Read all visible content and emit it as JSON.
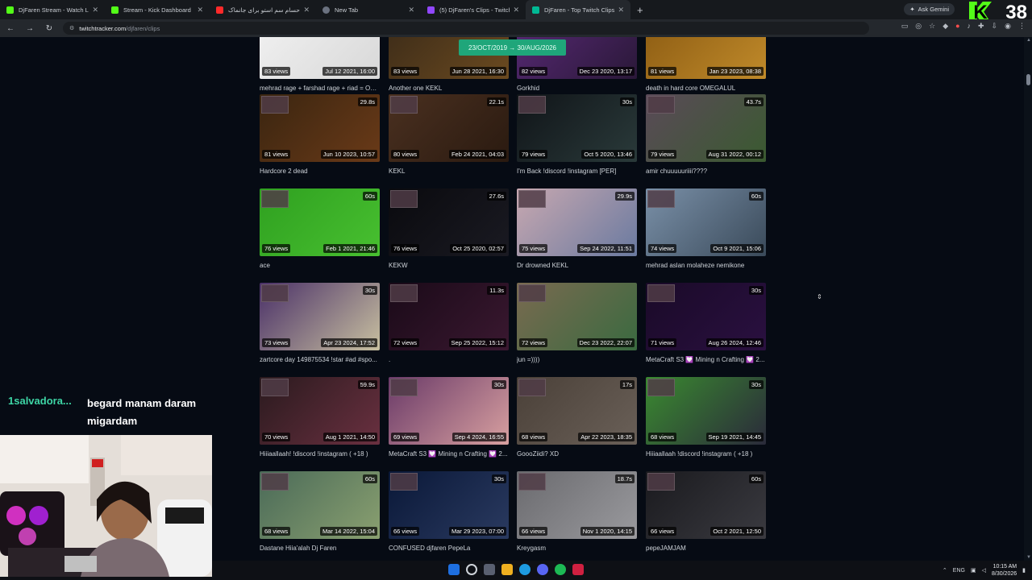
{
  "browser": {
    "tabs": [
      {
        "label": "DjFaren Stream - Watch Live o",
        "icon": "kick",
        "active": false
      },
      {
        "label": "Stream - Kick Dashboard",
        "icon": "kick",
        "active": false
      },
      {
        "label": "جیران حسام سم استو برای جانماک",
        "icon": "yt",
        "active": false
      },
      {
        "label": "New Tab",
        "icon": "nt",
        "active": false
      },
      {
        "label": "(5) DjFaren's Clips - Twitch",
        "icon": "tw",
        "active": false
      },
      {
        "label": "DjFaren - Top Twitch Clips",
        "icon": "tt",
        "active": true
      }
    ],
    "new_tab": "+",
    "ask_gemini": "Ask Gemini",
    "address": {
      "domain": "twitchtracker.com",
      "path": "/djfaren/clips"
    }
  },
  "overlay": {
    "viewer_count": "38",
    "chat_user": "1salvadora...",
    "chat_message": "begard manam daram migardam"
  },
  "date_range": "23/OCT/2019 → 30/AUG/2026",
  "clips": [
    [
      {
        "views": "83 views",
        "date": "Jul 12 2021, 16:00",
        "duration": "",
        "title": "mehrad rage + farshad rage + riad = OM...",
        "bg": "#f2f2f2",
        "bg2": "#d8d8d8"
      },
      {
        "views": "83 views",
        "date": "Jun 28 2021, 16:30",
        "duration": "",
        "title": "Another one KEKL",
        "bg": "#3a2a18",
        "bg2": "#6b4a20"
      },
      {
        "views": "82 views",
        "date": "Dec 23 2020, 13:17",
        "duration": "",
        "title": "Gorkhid",
        "bg": "#5a2a78",
        "bg2": "#2a1838"
      },
      {
        "views": "81 views",
        "date": "Jan 23 2023, 08:38",
        "duration": "",
        "title": "death in hard core OMEGALUL",
        "bg": "#8a5a12",
        "bg2": "#c08a2a"
      }
    ],
    [
      {
        "views": "81 views",
        "date": "Jun 10 2023, 10:57",
        "duration": "29.8s",
        "title": "Hardcore 2 dead",
        "bg": "#3a2510",
        "bg2": "#6a3a18"
      },
      {
        "views": "80 views",
        "date": "Feb 24 2021, 04:03",
        "duration": "22.1s",
        "title": "KEKL",
        "bg": "#4a3020",
        "bg2": "#2a1a10"
      },
      {
        "views": "79 views",
        "date": "Oct 5 2020, 13:46",
        "duration": "30s",
        "title": "I'm Back !discord !instagram [PER]",
        "bg": "#101418",
        "bg2": "#2a3a3a"
      },
      {
        "views": "79 views",
        "date": "Aug 31 2022, 00:12",
        "duration": "43.7s",
        "title": "amir chuuuuuriiii????",
        "bg": "#5a4a58",
        "bg2": "#3a5a30"
      }
    ],
    [
      {
        "views": "76 views",
        "date": "Feb 1 2021, 21:46",
        "duration": "60s",
        "title": "ace",
        "bg": "#2fa020",
        "bg2": "#48c030"
      },
      {
        "views": "76 views",
        "date": "Oct 25 2020, 02:57",
        "duration": "27.6s",
        "title": "KEKW",
        "bg": "#0a0a0e",
        "bg2": "#1a1a22"
      },
      {
        "views": "75 views",
        "date": "Sep 24 2022, 11:51",
        "duration": "29.9s",
        "title": "Dr drowned KEKL",
        "bg": "#c8a8b0",
        "bg2": "#6a7aa0"
      },
      {
        "views": "74 views",
        "date": "Oct 9 2021, 15:06",
        "duration": "60s",
        "title": "mehrad aslan molaheze nemikone",
        "bg": "#7a90a8",
        "bg2": "#3a4a5a"
      }
    ],
    [
      {
        "views": "73 views",
        "date": "Apr 23 2024, 17:52",
        "duration": "30s",
        "title": "zartcore day 149875534 !star #ad #spo...",
        "bg": "#4a3068",
        "bg2": "#c8c0a0"
      },
      {
        "views": "72 views",
        "date": "Sep 25 2022, 15:12",
        "duration": "11.3s",
        "title": ".",
        "bg": "#1a0a18",
        "bg2": "#3a1830"
      },
      {
        "views": "72 views",
        "date": "Dec 23 2022, 22:07",
        "duration": "",
        "title": "jun =))))",
        "bg": "#7a6a50",
        "bg2": "#3a6a40"
      },
      {
        "views": "71 views",
        "date": "Aug 26 2024, 12:46",
        "duration": "30s",
        "title": "MetaCraft S3 💟 Mining n Crafting 💟 2...",
        "bg": "#1a0a28",
        "bg2": "#2a1040"
      }
    ],
    [
      {
        "views": "70 views",
        "date": "Aug 1 2021, 14:50",
        "duration": "59.9s",
        "title": "Hiiiaallaah! !discord !instagram ( +18 )",
        "bg": "#2a1a1e",
        "bg2": "#6a3040"
      },
      {
        "views": "69 views",
        "date": "Sep 4 2024, 16:55",
        "duration": "30s",
        "title": "MetaCraft S3 💟 Mining n Crafting 💟 2...",
        "bg": "#6a3a68",
        "bg2": "#d8a0a0"
      },
      {
        "views": "68 views",
        "date": "Apr 22 2023, 18:35",
        "duration": "17s",
        "title": "GoooZiidi? XD",
        "bg": "#4a4038",
        "bg2": "#6a6058"
      },
      {
        "views": "68 views",
        "date": "Sep 19 2021, 14:45",
        "duration": "30s",
        "title": "Hiiiaallaah !discord !instagram ( +18 )",
        "bg": "#3a8a30",
        "bg2": "#2a2a3a"
      }
    ],
    [
      {
        "views": "68 views",
        "date": "Mar 14 2022, 15:04",
        "duration": "60s",
        "title": "Dastane Hiia'alah Dj Faren",
        "bg": "#4a6a58",
        "bg2": "#8aa070"
      },
      {
        "views": "66 views",
        "date": "Mar 29 2023, 07:00",
        "duration": "30s",
        "title": "CONFUSED djfaren PepeLa",
        "bg": "#0a1838",
        "bg2": "#2a3a60"
      },
      {
        "views": "66 views",
        "date": "Nov 1 2020, 14:15",
        "duration": "18.7s",
        "title": "Kreygasm",
        "bg": "#6a6a6e",
        "bg2": "#9a9a9e"
      },
      {
        "views": "66 views",
        "date": "Oct 2 2021, 12:50",
        "duration": "60s",
        "title": "pepeJAMJAM",
        "bg": "#1a1a1e",
        "bg2": "#3a3a40"
      }
    ]
  ],
  "taskbar": {
    "lang": "ENG",
    "time": "10:15 AM",
    "date": "8/30/2026"
  }
}
